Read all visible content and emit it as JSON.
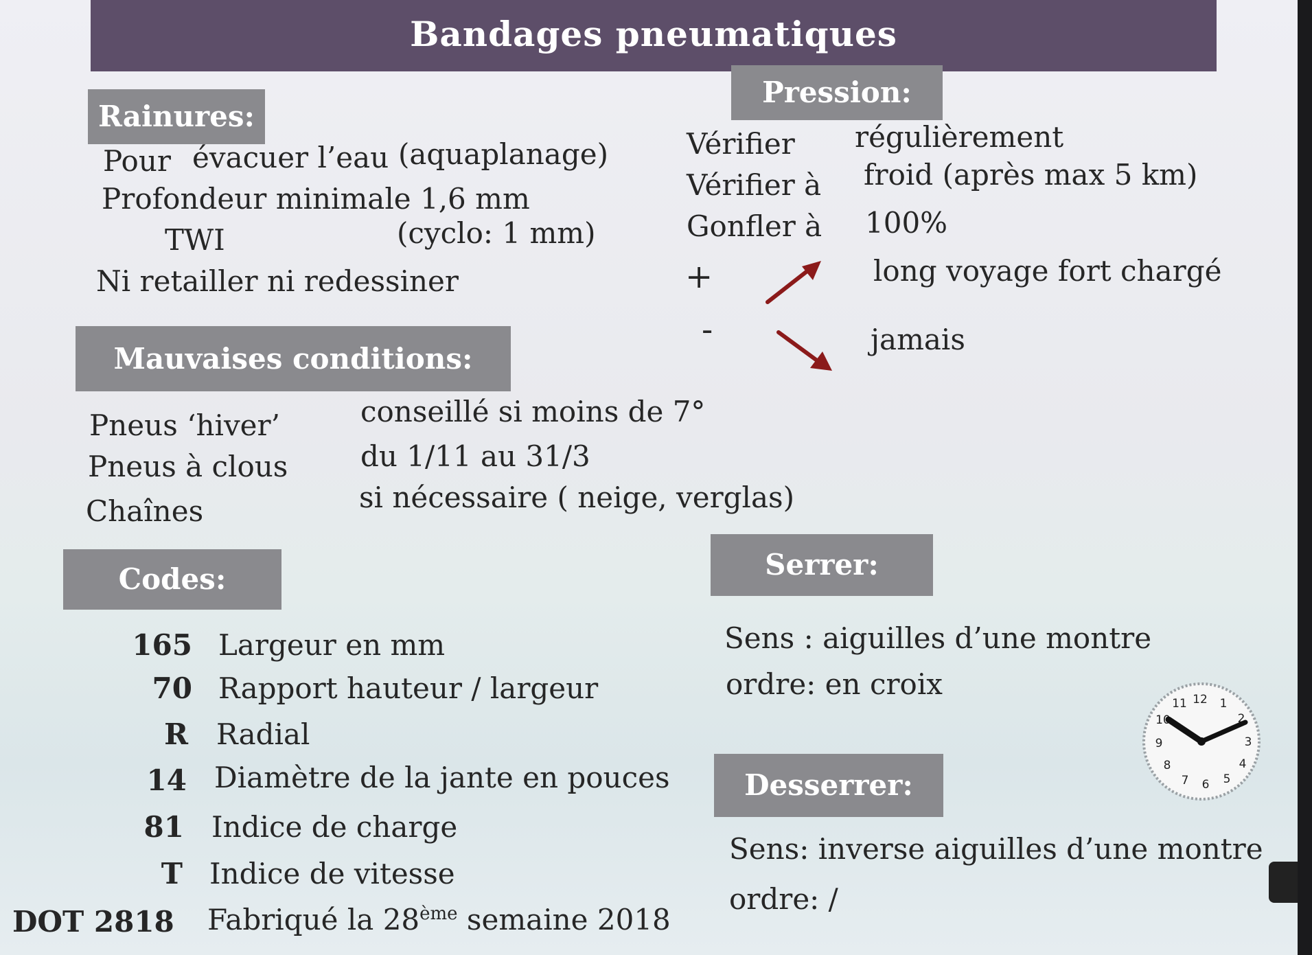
{
  "title": "Bandages pneumatiques",
  "rainures": {
    "heading": "Rainures:",
    "line1_a": "Pour",
    "line1_b": "évacuer l’eau",
    "line1_c": "(aquaplanage)",
    "line2": "Profondeur minimale 1,6 mm",
    "line3_a": "TWI",
    "line3_b": "(cyclo: 1 mm)",
    "line4": "Ni retailler ni redessiner"
  },
  "pression": {
    "heading": "Pression:",
    "r1_a": "Vérifier",
    "r1_b": "régulièrement",
    "r2_a": "Vérifier à",
    "r2_b": "froid (après max 5 km)",
    "r3_a": "Gonfler à",
    "r3_b": "100%",
    "plus": "+",
    "plus_text": "long voyage fort chargé",
    "minus": "-",
    "minus_text": "jamais",
    "arrow_color": "#8b1a1a"
  },
  "mauvaises": {
    "heading": "Mauvaises conditions:",
    "rows": [
      {
        "label": "Pneus ‘hiver’",
        "value": "conseillé si moins de 7°"
      },
      {
        "label": "Pneus à clous",
        "value": "du 1/11 au 31/3"
      },
      {
        "label": "Chaînes",
        "value": "si nécessaire ( neige, verglas)"
      }
    ]
  },
  "codes": {
    "heading": "Codes:",
    "rows": [
      {
        "code": "165",
        "desc": "Largeur en mm"
      },
      {
        "code": "70",
        "desc": "Rapport hauteur / largeur"
      },
      {
        "code": "R",
        "desc": "Radial"
      },
      {
        "code": "14",
        "desc": "Diamètre de la jante en pouces"
      },
      {
        "code": "81",
        "desc": "Indice de charge"
      },
      {
        "code": "T",
        "desc": "Indice de vitesse"
      }
    ],
    "dot_code": "DOT 2818",
    "dot_desc_a": "Fabriqué la 28",
    "dot_desc_sup": "ème",
    "dot_desc_b": " semaine 2018"
  },
  "serrer": {
    "heading": "Serrer:",
    "line1": "Sens : aiguilles d’une montre",
    "line2": "ordre: en croix"
  },
  "desserrer": {
    "heading": "Desserrer:",
    "line1": "Sens: inverse aiguilles d’une montre",
    "line2": "ordre: /"
  },
  "clock": {
    "numbers": [
      "12",
      "1",
      "2",
      "3",
      "4",
      "5",
      "6",
      "7",
      "8",
      "9",
      "10",
      "11"
    ]
  },
  "colors": {
    "title_bar": "#5d4e69",
    "header_box": "#8a8a8e"
  }
}
